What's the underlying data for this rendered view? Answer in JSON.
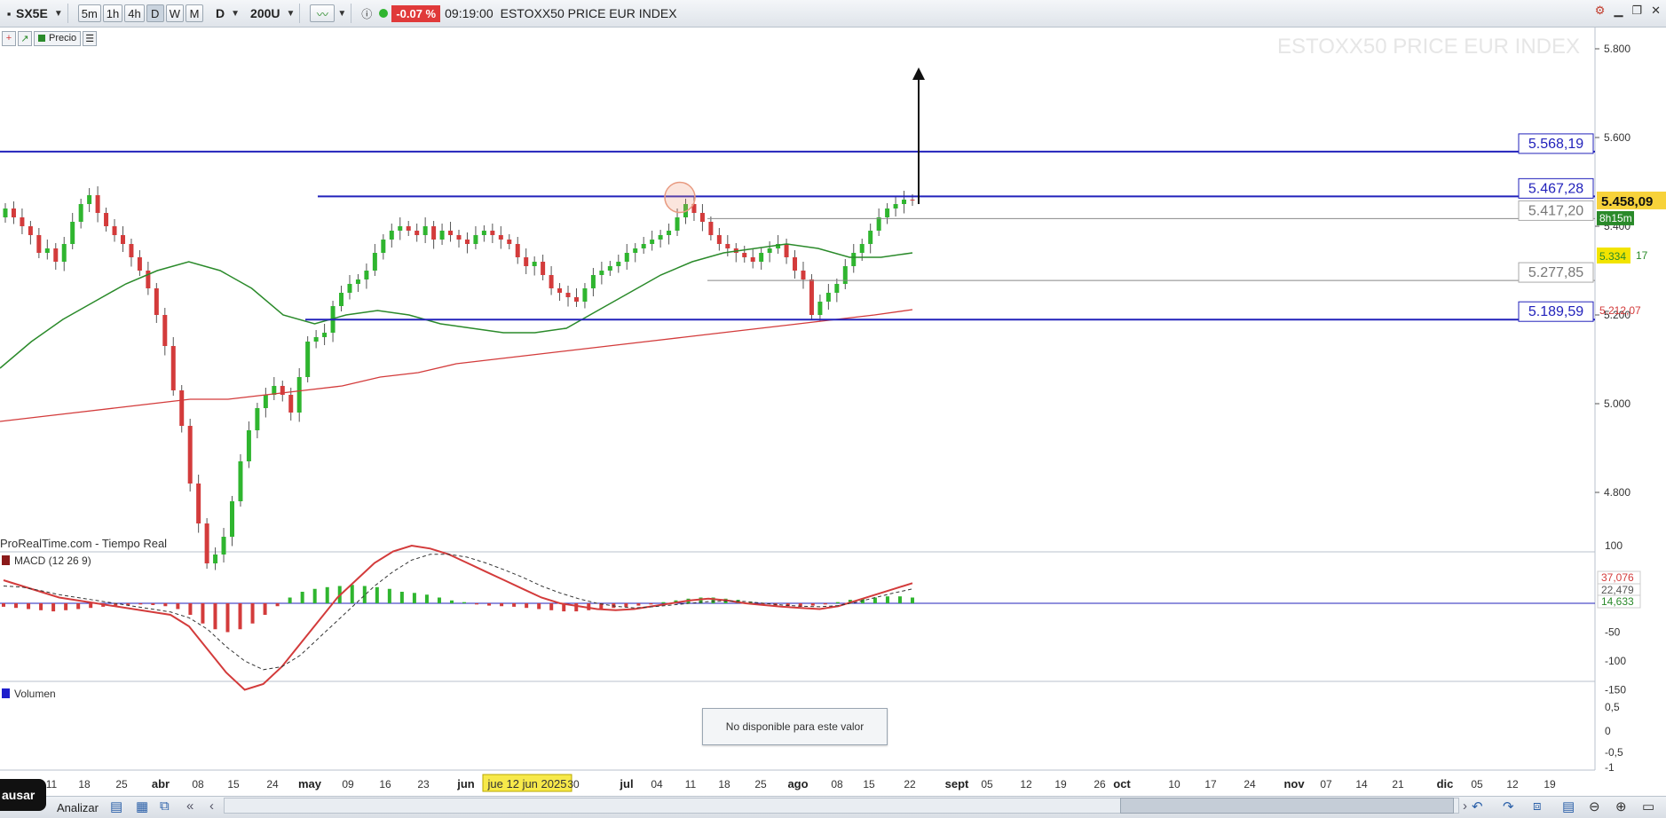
{
  "toolbar": {
    "symbol": "SX5E",
    "timeframes": [
      "5m",
      "1h",
      "4h",
      "D",
      "W",
      "M"
    ],
    "period": "D",
    "bars": "200U",
    "change_badge": "-0.07 %",
    "time": "09:19:00",
    "instrument": "ESTOXX50 PRICE EUR INDEX"
  },
  "subbar": {
    "price_label": "Precio"
  },
  "chart_data": [
    {
      "type": "candlestick",
      "title": "ESTOXX50 PRICE EUR INDEX",
      "source": "ProRealTime.com - Tiempo Real",
      "x_ticks": [
        "11",
        "18",
        "25",
        "abr",
        "08",
        "15",
        "24",
        "may",
        "09",
        "16",
        "23",
        "jun",
        "jue 12 jun 2025",
        "30",
        "jul",
        "04",
        "11",
        "18",
        "25",
        "ago",
        "08",
        "15",
        "22",
        "sept",
        "05",
        "12",
        "19",
        "26",
        "oct",
        "10",
        "17",
        "24",
        "nov",
        "07",
        "14",
        "21",
        "dic",
        "05",
        "12",
        "19"
      ],
      "y_ticks": [
        "5.800",
        "5.600",
        "5.400",
        "5.200",
        "5.000",
        "4.800"
      ],
      "ylim": [
        4630,
        5860
      ],
      "last_price": "5.458,09",
      "countdown": "8h15m",
      "horizontal_levels": [
        {
          "label": "5.568,19",
          "value": 5568.19,
          "color": "#2222bb"
        },
        {
          "label": "5.467,28",
          "value": 5467.28,
          "color": "#2222bb"
        },
        {
          "label": "5.417,20",
          "value": 5417.2,
          "color": "#888888"
        },
        {
          "label": "5.277,85",
          "value": 5277.85,
          "color": "#888888"
        },
        {
          "label": "5.189,59",
          "value": 5189.59,
          "color": "#2222bb"
        }
      ],
      "moving_average_labels": [
        {
          "label": "5.334",
          "suffix": "17",
          "color": "#2a8a2a"
        },
        {
          "label": "5.212,07",
          "color": "#d33b3b"
        }
      ],
      "colors": {
        "up": "#2fb52f",
        "down": "#d33b3b",
        "ma_short": "#2a8a2a",
        "ma_long": "#d33b3b",
        "level": "#2222bb"
      }
    },
    {
      "type": "line",
      "title": "MACD (12 26 9)",
      "y_ticks": [
        "100",
        "-50",
        "-100",
        "-150"
      ],
      "value_labels": [
        "37,076",
        "22,479",
        "14,633"
      ]
    },
    {
      "type": "bar",
      "title": "Volumen",
      "y_ticks": [
        "0,5",
        "0",
        "-0,5",
        "-1"
      ],
      "message": "No disponible para este valor"
    }
  ],
  "bottombar": {
    "pause_label": "ausar",
    "analyze_label": "Analizar"
  },
  "icons": [
    "chart-style-icon",
    "info-icon",
    "settings-icon",
    "minimize-icon",
    "restore-icon",
    "close-icon",
    "undo-icon",
    "zoom-in-icon",
    "zoom-out-icon"
  ]
}
